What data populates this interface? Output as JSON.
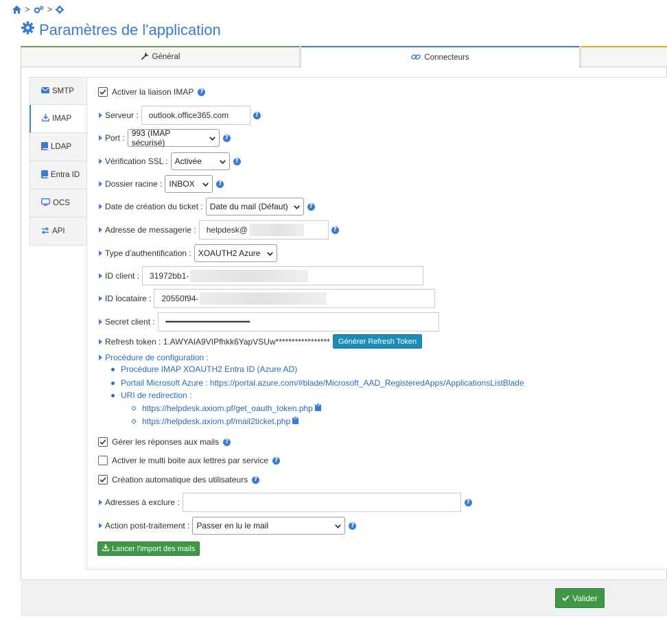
{
  "page": {
    "title": "Paramètres de l'application"
  },
  "breadcrumb": {
    "separator": ">"
  },
  "top_tabs": [
    {
      "label": "Général"
    },
    {
      "label": "Connecteurs"
    },
    {
      "label": ""
    }
  ],
  "side_tabs": [
    {
      "label": "SMTP"
    },
    {
      "label": "IMAP"
    },
    {
      "label": "LDAP"
    },
    {
      "label": "Entra ID"
    },
    {
      "label": "OCS"
    },
    {
      "label": "API"
    }
  ],
  "imap": {
    "enable_label": "Activer la liaison IMAP",
    "server_label": "Serveur :",
    "server_value": "outlook.office365.com",
    "port_label": "Port :",
    "port_value": "993 (IMAP sécurisé)",
    "ssl_label": "Vérification SSL :",
    "ssl_value": "Activée",
    "folder_label": "Dossier racine :",
    "folder_value": "INBOX",
    "date_label": "Date de création du ticket :",
    "date_value": "Date du mail (Défaut)",
    "email_label": "Adresse de messagerie :",
    "email_value": "helpdesk@",
    "auth_label": "Type d'authentification :",
    "auth_value": "XOAUTH2 Azure",
    "client_id_label": "ID client :",
    "client_id_value": "31972bb1-",
    "tenant_label": "ID locataire :",
    "tenant_value": "20550f94-",
    "secret_label": "Secret client :",
    "secret_value": "•••••••••••••••••••••••••••••••••••••••••••••••••••••••••••••••••••••••••••••••",
    "refresh_label": "Refresh token : 1.AWYAIA9VIPfhkk6YapVSUw*****************",
    "refresh_button": "Générer Refresh Token",
    "procedure_label": "Procédure de configuration :",
    "procedure_items": [
      "Procédure IMAP XOAUTH2 Entra ID (Azure AD)",
      "Portail Microsoft Azure : https://portal.azure.com/#blade/Microsoft_AAD_RegisteredApps/ApplicationsListBlade",
      "URI de redirection :"
    ],
    "redirect_uris": [
      "https://helpdesk.axiom.pf/get_oauth_token.php",
      "https://helpdesk.axiom.pf/mail2ticket.php"
    ],
    "replies_label": "Gérer les réponses aux mails",
    "multibox_label": "Activer le multi boite aux lettres par service",
    "autocreate_label": "Création automatique des utilisateurs",
    "exclude_label": "Adresses à exclure :",
    "exclude_value": "",
    "post_label": "Action post-traitement :",
    "post_value": "Passer en lu le mail",
    "import_button": "Lancer l'import des mails"
  },
  "footer": {
    "validate_button": "Valider"
  },
  "colors": {
    "accent": "#3a7bd5",
    "success": "#3f9748",
    "info": "#1d8cb4"
  }
}
